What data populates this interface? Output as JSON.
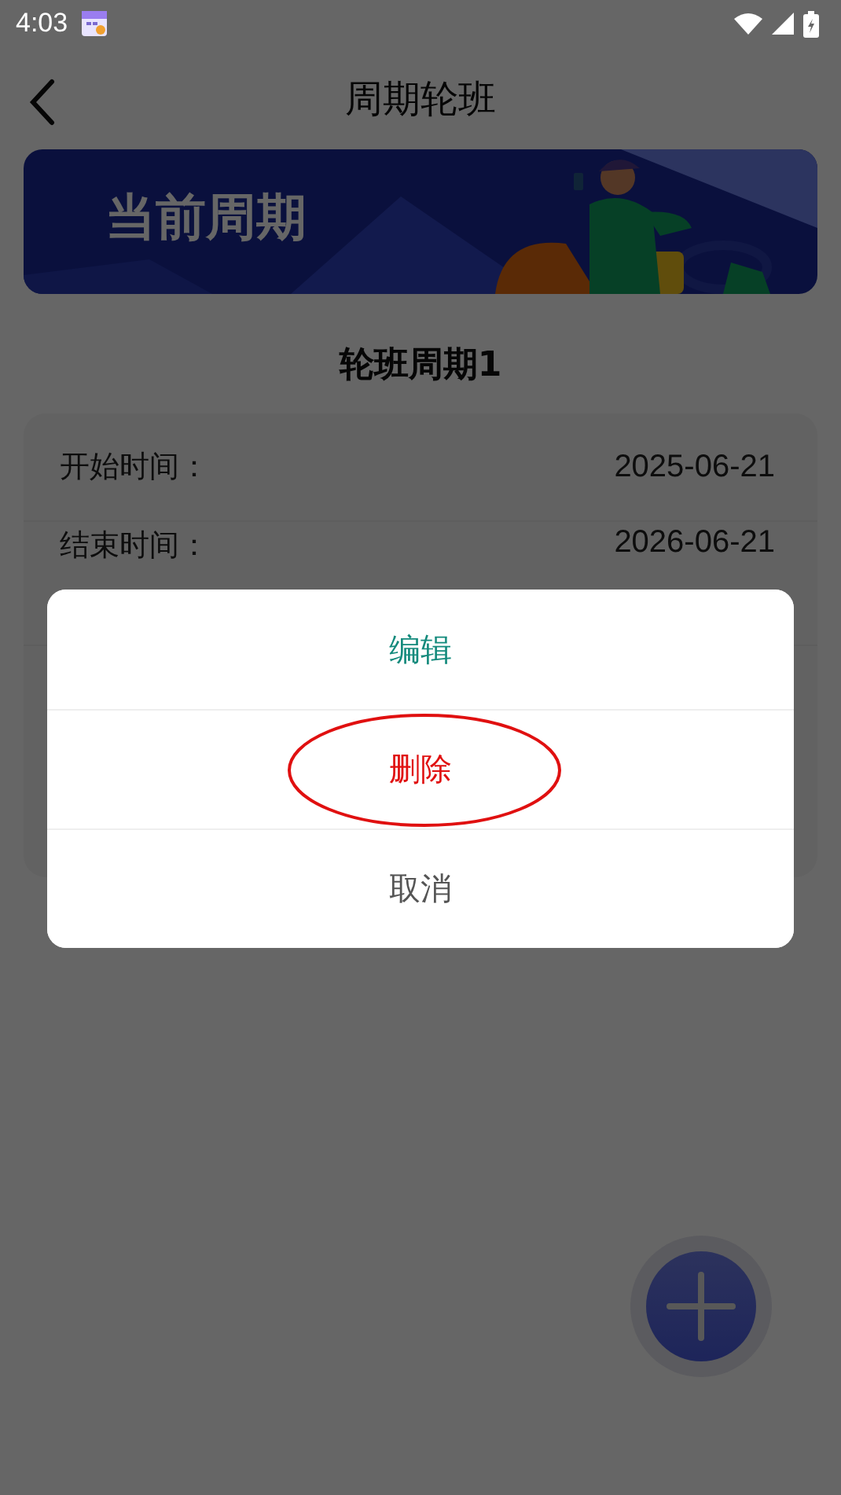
{
  "status_bar": {
    "time": "4:03"
  },
  "header": {
    "title": "周期轮班"
  },
  "banner": {
    "title": "当前周期"
  },
  "cycle": {
    "name": "轮班周期1",
    "rows": [
      {
        "label": "开始时间：",
        "value": "2025-06-21"
      },
      {
        "label": "结束时间：",
        "value": "2026-06-21"
      }
    ]
  },
  "action_sheet": {
    "items": [
      {
        "label": "编辑",
        "kind": "primary",
        "highlighted": false
      },
      {
        "label": "删除",
        "kind": "danger",
        "highlighted": true
      },
      {
        "label": "取消",
        "kind": "cancel",
        "highlighted": false
      }
    ]
  }
}
